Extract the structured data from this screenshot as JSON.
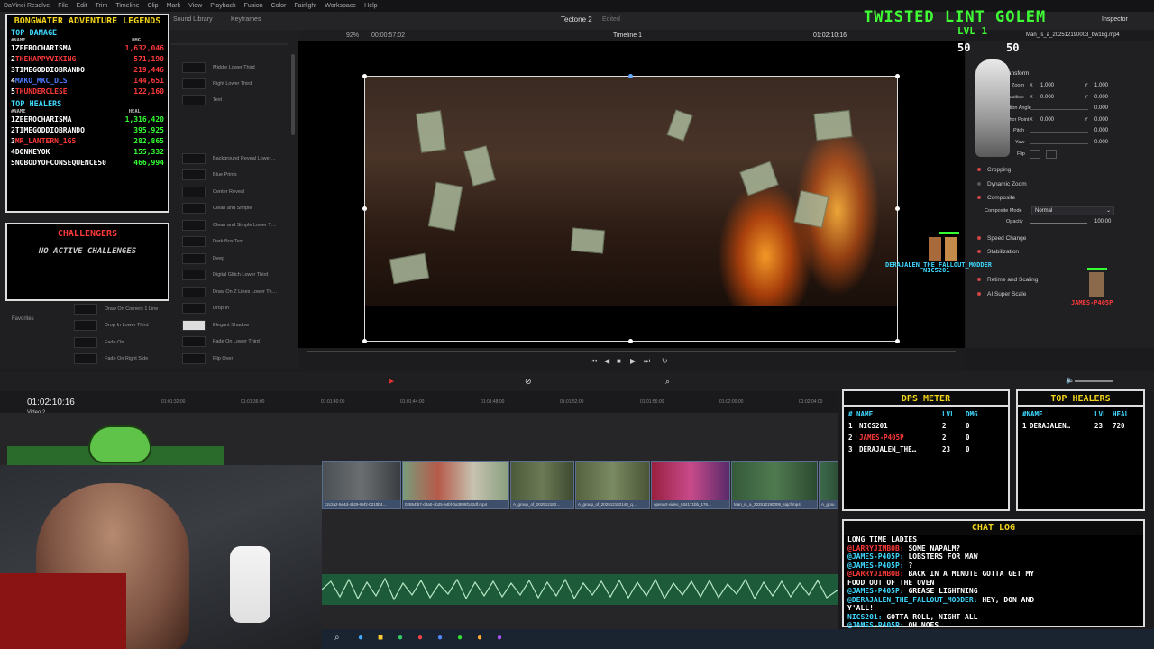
{
  "menu": {
    "app": "DaVinci Resolve",
    "items": [
      "File",
      "Edit",
      "Trim",
      "Timeline",
      "Clip",
      "Mark",
      "View",
      "Playback",
      "Fusion",
      "Color",
      "Fairlight",
      "Workspace",
      "Help"
    ]
  },
  "toolbar": {
    "sound_library": "Sound Library",
    "keyframes": "Keyframes",
    "project": "Tectone 2",
    "project_status": "Edited",
    "inspector": "Inspector"
  },
  "viewer": {
    "zoom": "92%",
    "source_tc": "00:00:57:02",
    "timeline_name": "Timeline 1",
    "record_tc": "01:02:10:16",
    "clip_name": "Man_is_a_202512190003_bw18g.mp4"
  },
  "effects": {
    "col1": [
      "Middle Lower Third",
      "Right Lower Third",
      "Text",
      "Background Reveal Lower…",
      "Blue Prints",
      "Center Reveal",
      "Clean and Simple",
      "Clean and Simple Lower T…",
      "Dark Box Text",
      "Deep",
      "Digital Glitch Lower Third",
      "Draw On Z Lines Lower Th…",
      "Drop In",
      "Elegant Shadow",
      "Fade On Lower Third",
      "Flip Over"
    ],
    "col0": [
      "Draw On Corners 1 Line",
      "Drop In Lower Third",
      "Fade On",
      "Fade On Right Side"
    ],
    "favorites": "Favorites"
  },
  "inspector": {
    "zoom_x": "1.000",
    "zoom_y": "1.000",
    "pos_x": "0.000",
    "pos_y": "0.000",
    "angle": "0.000",
    "anchor_x": "0.000",
    "anchor_y": "0.000",
    "pitch": "0.000",
    "yaw": "0.000",
    "labels": {
      "zoom": "Zoom",
      "position": "Position",
      "angle": "Rotation Angle",
      "anchor": "Anchor Point",
      "pitch": "Pitch",
      "yaw": "Yaw",
      "flip": "Flip",
      "x": "X",
      "y": "Y"
    },
    "sections": [
      "Cropping",
      "Dynamic Zoom",
      "Composite",
      "Speed Change",
      "Stabilization",
      "Retime and Scaling",
      "AI Super Scale"
    ],
    "composite_mode_label": "Composite Mode",
    "composite_mode": "Normal",
    "opacity_label": "Opacity",
    "opacity": "100.00",
    "transform": "Transform"
  },
  "timeline": {
    "timecode": "01:02:10:16",
    "ruler": [
      "01:01:28:00",
      "01:01:32:00",
      "01:01:36:00",
      "01:01:40:00",
      "01:01:44:00",
      "01:01:48:00",
      "01:01:52:00",
      "01:01:56:00",
      "01:02:00:00",
      "01:02:04:00"
    ],
    "track": "Video 2",
    "clips": [
      "c2c2a2-5e4d-4b29-9ef2-0210b4…",
      "02854fb7-d2a0-4b25-a4bf-0a3898f142df.mp4",
      "A_group_of_202512182…",
      "A_group_of_202512182148_q…",
      "openart-video_634171bb_176…",
      "Man_is_a_202512190006_siqcf.mp4",
      "A_grou"
    ]
  },
  "overlay": {
    "leaderboard_title": "BONGWATER ADVENTURE LEGENDS",
    "top_damage": "TOP DAMAGE",
    "top_healers": "TOP HEALERS",
    "name_h": "#NAME",
    "dmg_h": "DMG",
    "heal_h": "HEAL",
    "damage": [
      {
        "rank": "1",
        "name": "ZEEROCHARISMA",
        "value": "1,632,046"
      },
      {
        "rank": "2",
        "name": "THEHAPPYVIKING",
        "value": "571,190"
      },
      {
        "rank": "3",
        "name": "TIMEGODDIOBRANDO",
        "value": "219,446"
      },
      {
        "rank": "4",
        "name": "MAKO_MKC_DLS",
        "value": "144,651"
      },
      {
        "rank": "5",
        "name": "THUNDERCLESE",
        "value": "122,160"
      }
    ],
    "healers": [
      {
        "rank": "1",
        "name": "ZEEROCHARISMA",
        "value": "1,316,420"
      },
      {
        "rank": "2",
        "name": "TIMEGODDIOBRANDO",
        "value": "395,925"
      },
      {
        "rank": "3",
        "name": "MR_LANTERN_1G5",
        "value": "282,865"
      },
      {
        "rank": "4",
        "name": "DONKEYOK",
        "value": "155,332"
      },
      {
        "rank": "5",
        "name": "NOBODYOFCONSEQUENCE50",
        "value": "466,994"
      }
    ],
    "challenges_title": "CHALLENGERS",
    "challenges_empty": "NO ACTIVE CHALLENGES",
    "boss_name": "TWISTED LINT GOLEM",
    "boss_level": "LVL 1",
    "boss_hp": "50",
    "boss_hp_max": "50",
    "char_labels": [
      "DERAJALEN_THE_FALLOUT_MODDER",
      "NICS201",
      "JAMES-P405P"
    ]
  },
  "dps": {
    "title": "DPS METER",
    "h_name": "# NAME",
    "h_lvl": "LVL",
    "h_dmg": "DMG",
    "rows": [
      {
        "n": "1",
        "name": "NICS201",
        "lvl": "2",
        "dmg": "0"
      },
      {
        "n": "2",
        "name": "JAMES-P405P",
        "lvl": "2",
        "dmg": "0"
      },
      {
        "n": "3",
        "name": "DERAJALEN_THE…",
        "lvl": "23",
        "dmg": "0"
      }
    ]
  },
  "heals": {
    "title": "TOP HEALERS",
    "h_name": "#NAME",
    "h_lvl": "LVL",
    "h_heal": "HEAL",
    "rows": [
      {
        "n": "1",
        "name": "DERAJALEN…",
        "lvl": "23",
        "heal": "720"
      }
    ]
  },
  "chat": {
    "title": "CHAT LOG",
    "lines": [
      {
        "user": "",
        "text": "LONG TIME LADIES",
        "cls": "u3"
      },
      {
        "user": "@LARRYJIMBOB:",
        "text": " SOME NAPALM?",
        "cls": "u2"
      },
      {
        "user": "@JAMES-P405P:",
        "text": " LOBSTERS FOR MAW",
        "cls": "u1"
      },
      {
        "user": "@JAMES-P405P:",
        "text": " ?",
        "cls": "u1"
      },
      {
        "user": "@LARRYJIMBOB:",
        "text": " BACK IN A MINUTE GOTTA GET MY",
        "cls": "u2"
      },
      {
        "user": "",
        "text": "FOOD OUT OF THE OVEN",
        "cls": "u3"
      },
      {
        "user": "@JAMES-P405P:",
        "text": " GREASE LIGHTNING",
        "cls": "u1"
      },
      {
        "user": "@DERAJALEN_THE_FALLOUT_MODDER:",
        "text": " HEY, DON AND",
        "cls": "u1"
      },
      {
        "user": "",
        "text": "Y'ALL!",
        "cls": "u3"
      },
      {
        "user": "NICS201:",
        "text": " GOTTA ROLL, NIGHT ALL",
        "cls": "u1"
      },
      {
        "user": "@JAMES-P405P:",
        "text": " OH NOES",
        "cls": "u1"
      }
    ]
  },
  "colors": {
    "overlay_yellow": "#f2d41a",
    "overlay_cyan": "#3fd9ff",
    "overlay_red": "#ff3a3a",
    "overlay_green": "#3fff35",
    "resolve_bg": "#1b1b1d"
  }
}
